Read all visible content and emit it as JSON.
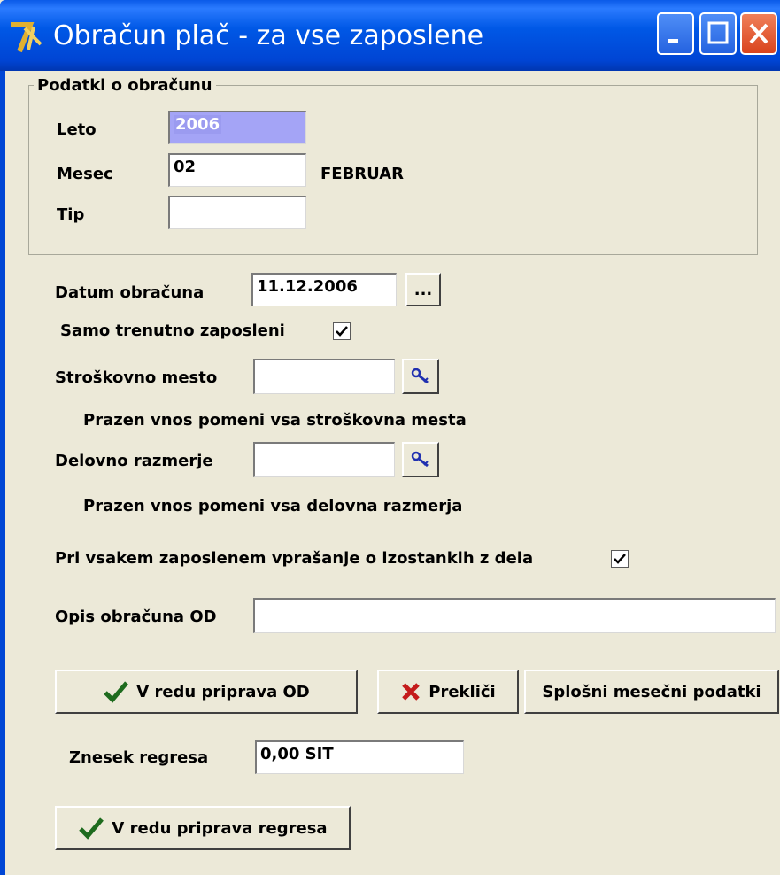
{
  "window": {
    "title": "Obračun plač - za vse zaposlene"
  },
  "group": {
    "title": "Podatki o obračunu",
    "leto_label": "Leto",
    "leto_value": "2006",
    "mesec_label": "Mesec",
    "mesec_value": "02",
    "mesec_name": "FEBRUAR",
    "tip_label": "Tip",
    "tip_value": ""
  },
  "datum": {
    "label": "Datum obračuna",
    "value": "11.12.2006",
    "picker_label": "..."
  },
  "samo": {
    "label": "Samo  trenutno zaposleni",
    "checked": true
  },
  "strosek": {
    "label": "Stroškovno mesto",
    "value": "",
    "hint": "Prazen vnos pomeni vsa stroškovna mesta"
  },
  "delovno": {
    "label": "Delovno razmerje",
    "value": "",
    "hint": "Prazen vnos pomeni vsa delovna razmerja"
  },
  "izostanki": {
    "label": "Pri vsakem zaposlenem vprašanje o izostankih z dela",
    "checked": true
  },
  "opis": {
    "label": "Opis obračuna OD",
    "value": ""
  },
  "buttons": {
    "ok_od": "V redu priprava OD",
    "cancel": "Prekliči",
    "monthly": "Splošni mesečni podatki",
    "ok_regres": "V redu priprava regresa"
  },
  "regres": {
    "label": "Znesek regresa",
    "value": "0,00 SIT"
  },
  "colors": {
    "titlebar": "#0058e6",
    "face": "#ece9d8",
    "selection": "#a4a4f6",
    "ok_check": "#1e6b1e",
    "cancel_x": "#c41b1b"
  },
  "icons": [
    "app-icon",
    "minimize-icon",
    "maximize-icon",
    "close-icon",
    "lookup-icon",
    "checkmark-icon",
    "x-icon"
  ]
}
